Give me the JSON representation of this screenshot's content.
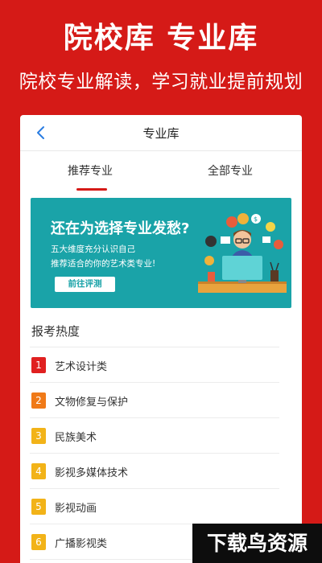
{
  "promo": {
    "title": "院校库  专业库",
    "subtitle": "院校专业解读，学习就业提前规划"
  },
  "nav": {
    "title": "专业库"
  },
  "tabs": [
    {
      "label": "推荐专业",
      "active": true
    },
    {
      "label": "全部专业",
      "active": false
    }
  ],
  "banner": {
    "title": "还在为选择专业发愁?",
    "line1": "五大维度充分认识自己",
    "line2": "推荐适合的你的艺术类专业!",
    "button": "前往评测"
  },
  "section": {
    "title": "报考热度"
  },
  "items": [
    {
      "rank": "1",
      "label": "艺术设计类",
      "color": "#e02020"
    },
    {
      "rank": "2",
      "label": "文物修复与保护",
      "color": "#f07a18"
    },
    {
      "rank": "3",
      "label": "民族美术",
      "color": "#f2b318"
    },
    {
      "rank": "4",
      "label": "影视多媒体技术",
      "color": "#f2b318"
    },
    {
      "rank": "5",
      "label": "影视动画",
      "color": "#f2b318"
    },
    {
      "rank": "6",
      "label": "广播影视类",
      "color": "#f2b318"
    }
  ],
  "watermark": "下载鸟资源",
  "colors": {
    "brand": "#d51a17",
    "banner": "#1aa3a8"
  }
}
